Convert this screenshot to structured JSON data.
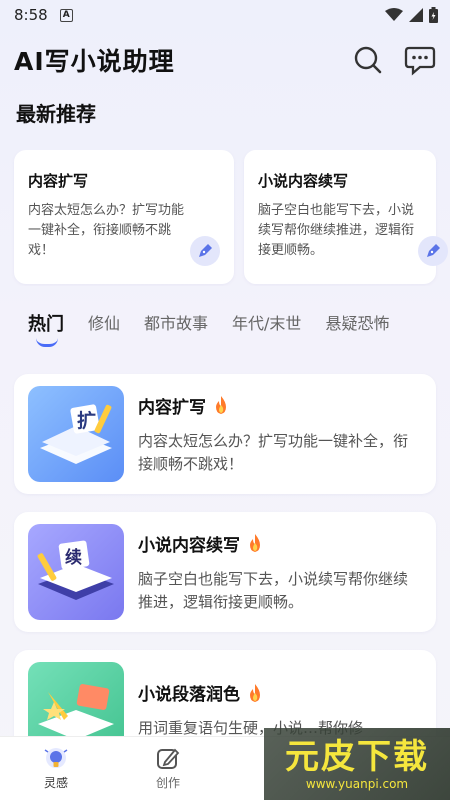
{
  "status": {
    "time": "8:58",
    "badge": "A"
  },
  "header": {
    "title": "AI写小说助理",
    "icons": [
      "search-icon",
      "chat-icon"
    ]
  },
  "featured": {
    "title": "最新推荐",
    "cards": [
      {
        "title": "内容扩写",
        "desc": "内容太短怎么办？扩写功能一键补全，衔接顺畅不跳戏！",
        "icon": "pen-icon"
      },
      {
        "title": "小说内容续写",
        "desc": "脑子空白也能写下去，小说续写帮你继续推进，逻辑衔接更顺畅。",
        "icon": "pen-icon"
      }
    ]
  },
  "tabs": [
    "热门",
    "修仙",
    "都市故事",
    "年代/末世",
    "悬疑恐怖"
  ],
  "items": [
    {
      "title": "内容扩写",
      "desc": "内容太短怎么办？扩写功能一键补全，衔接顺畅不跳戏！",
      "thumb_glyph": "扩",
      "badge": "fire-icon"
    },
    {
      "title": "小说内容续写",
      "desc": "脑子空白也能写下去，小说续写帮你继续推进，逻辑衔接更顺畅。",
      "thumb_glyph": "续",
      "badge": "fire-icon"
    },
    {
      "title": "小说段落润色",
      "desc": "用词重复语句生硬，小说…帮你修",
      "thumb_glyph": "",
      "badge": "fire-icon"
    }
  ],
  "nav": [
    {
      "label": "灵感",
      "icon": "lightbulb-icon",
      "active": true
    },
    {
      "label": "创作",
      "icon": "edit-icon",
      "active": false
    }
  ],
  "watermark": {
    "main": "元皮下载",
    "sub": "www.yuanpi.com"
  },
  "colors": {
    "accent": "#4a6cf7",
    "fire": "#ff7a2a",
    "watermark": "#f5e63d"
  }
}
